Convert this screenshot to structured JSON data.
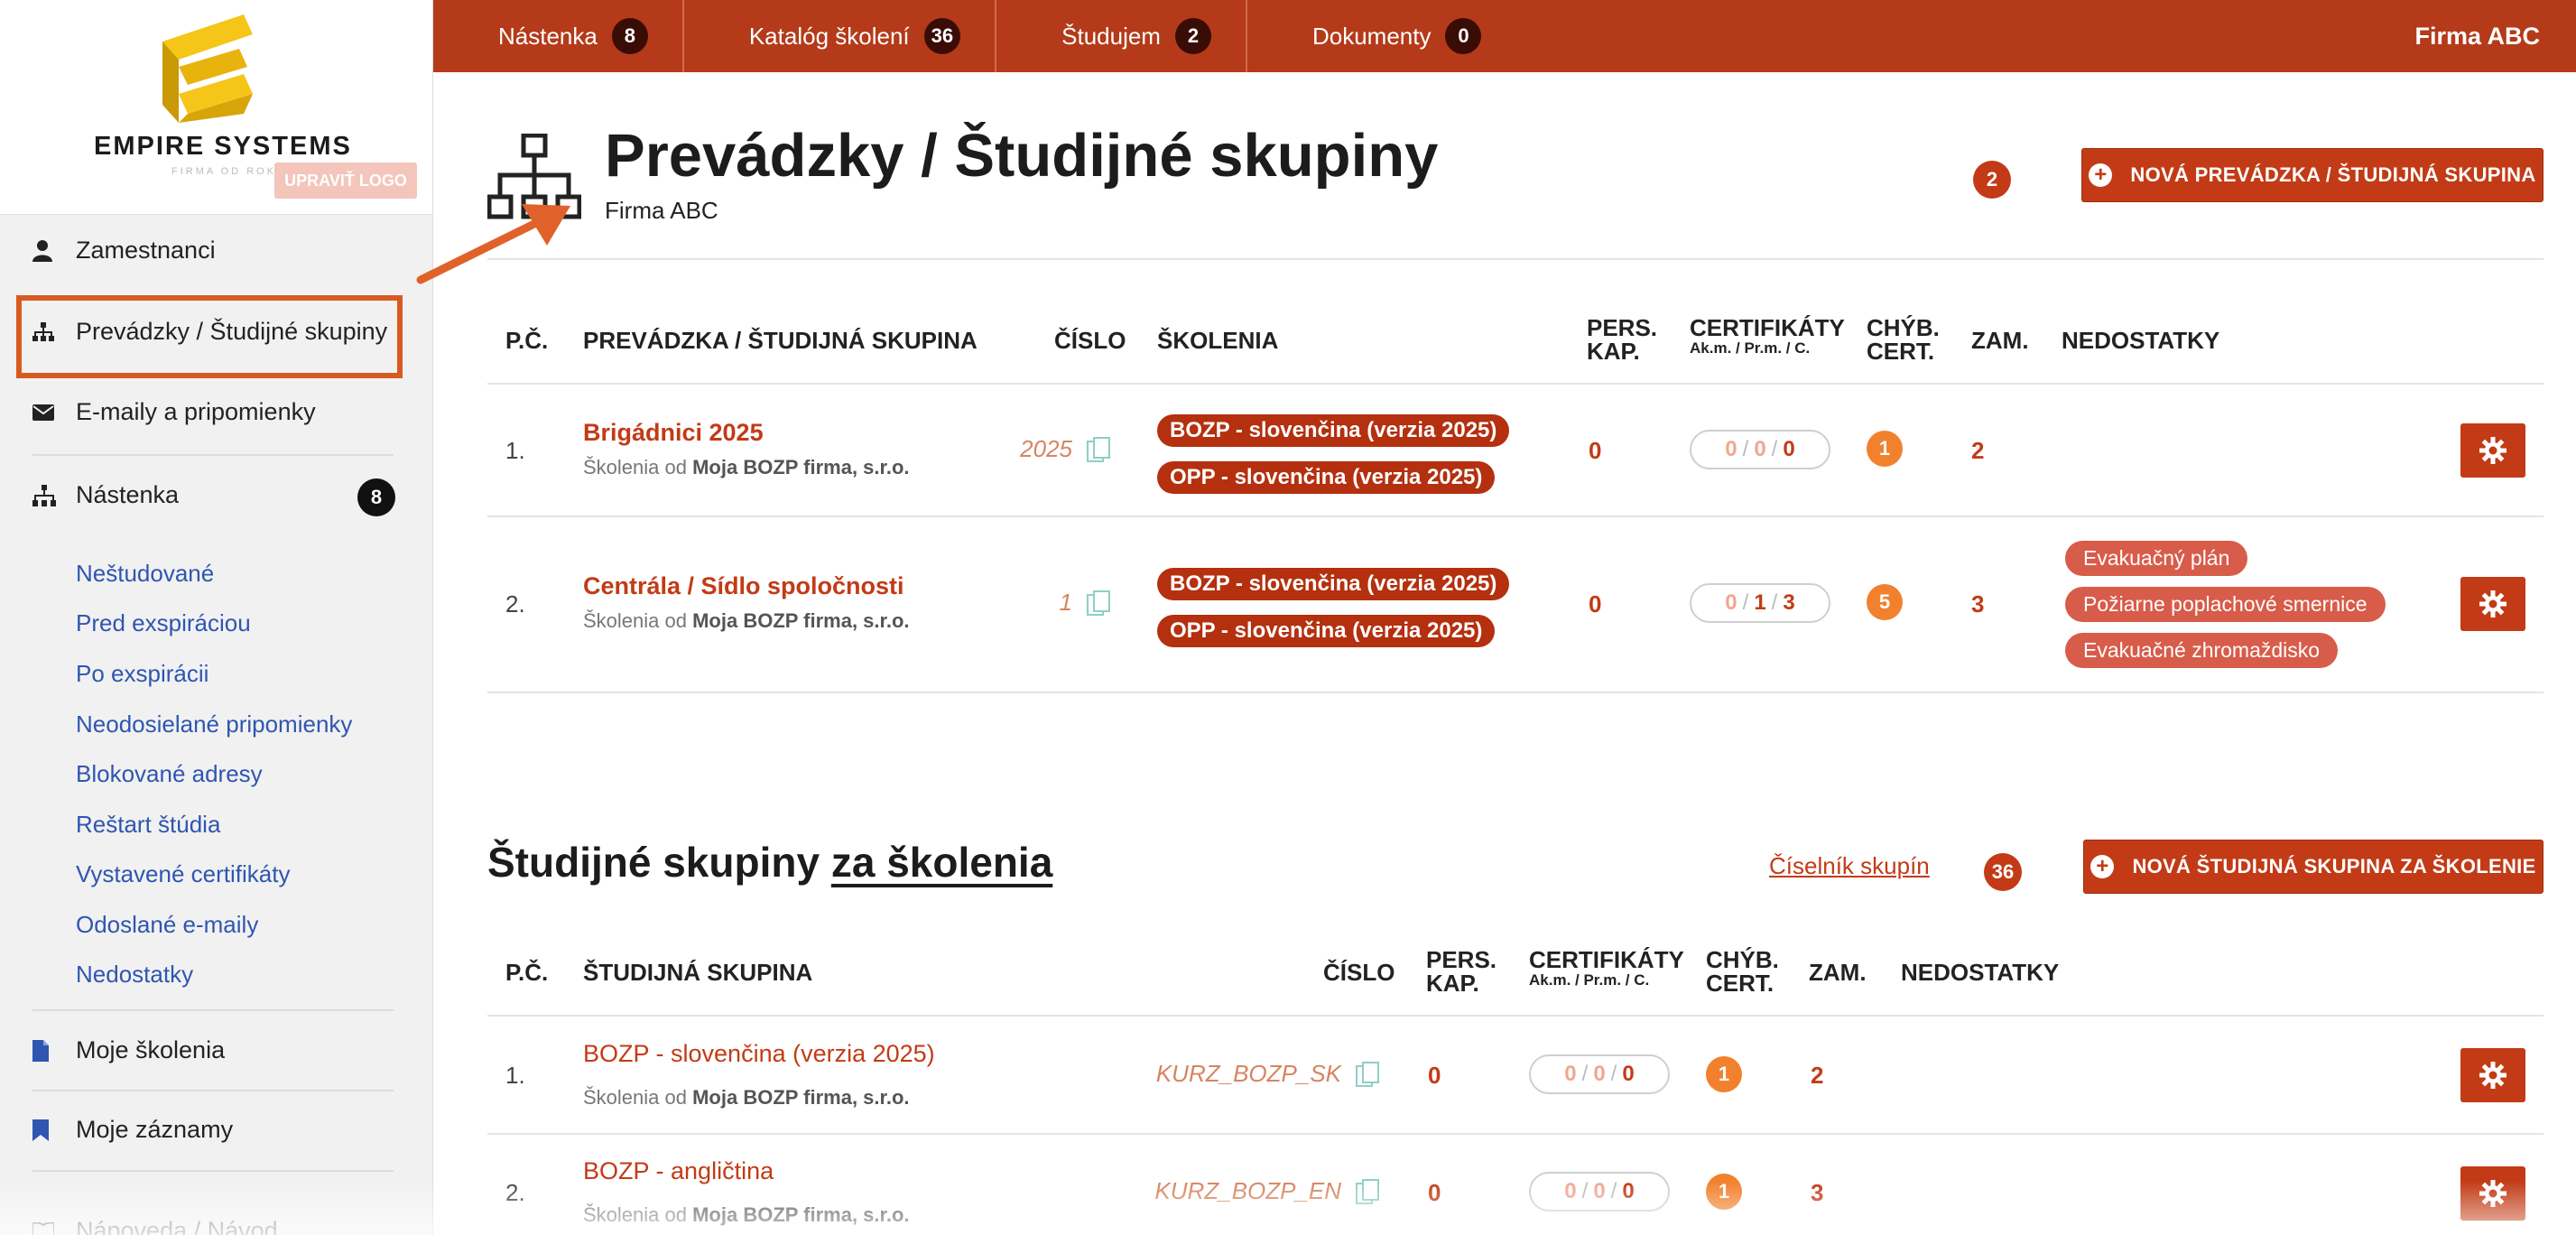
{
  "sidebar": {
    "logo_text": "EMPIRE SYSTEMS",
    "logo_sub": "FIRMA OD ROKU",
    "logo_button": "UPRAVIŤ LOGO",
    "items": [
      {
        "label": "Zamestnanci",
        "icon": "person-icon"
      },
      {
        "label": "Prevádzky / Študijné skupiny",
        "icon": "sitemap-icon",
        "active": true
      },
      {
        "label": "E-maily a pripomienky",
        "icon": "envelope-icon"
      },
      {
        "label": "Nástenka",
        "icon": "dashboard-icon",
        "badge": "8"
      }
    ],
    "sub_links": [
      "Neštudované",
      "Pred exspiráciou",
      "Po exspirácii",
      "Neodosielané pripomienky",
      "Blokované adresy",
      "Reštart štúdia",
      "Vystavené certifikáty",
      "Odoslané e-maily",
      "Nedostatky"
    ],
    "bottom_items": [
      {
        "label": "Moje školenia",
        "icon": "file-icon"
      },
      {
        "label": "Moje záznamy",
        "icon": "bookmark-icon"
      },
      {
        "label": "Nápoveda / Návod",
        "icon": "book-icon"
      }
    ]
  },
  "topbar": {
    "items": [
      {
        "label": "Nástenka",
        "badge": "8"
      },
      {
        "label": "Katalóg školení",
        "badge": "36"
      },
      {
        "label": "Študujem",
        "badge": "2"
      },
      {
        "label": "Dokumenty",
        "badge": "0"
      }
    ],
    "company": "Firma ABC"
  },
  "header": {
    "title": "Prevádzky / Študijné skupiny",
    "subtitle": "Firma ABC",
    "count": "2",
    "new_button": "NOVÁ PREVÁDZKA / ŠTUDIJNÁ SKUPINA"
  },
  "table1": {
    "columns": {
      "pc": "P.Č.",
      "name": "PREVÁDZKA / ŠTUDIJNÁ SKUPINA",
      "cislo": "ČÍSLO",
      "skolenia": "ŠKOLENIA",
      "pers1": "PERS.",
      "pers2": "KAP.",
      "cert": "CERTIFIKÁTY",
      "cert_sub": "Ak.m. / Pr.m. / C.",
      "chyb1": "CHÝB.",
      "chyb2": "CERT.",
      "zam": "ZAM.",
      "nedostatky": "NEDOSTATKY"
    },
    "rows": [
      {
        "num": "1.",
        "name": "Brigádnici 2025",
        "sub_prefix": "Školenia od",
        "sub_company": "Moja BOZP firma, s.r.o.",
        "cislo": "2025",
        "skolenia": [
          "BOZP - slovenčina (verzia 2025)",
          "OPP - slovenčina (verzia 2025)"
        ],
        "pers": "0",
        "cert": [
          "0",
          "0",
          "0"
        ],
        "chyb": "1",
        "zam": "2",
        "nedostatky": []
      },
      {
        "num": "2.",
        "name": "Centrála / Sídlo spoločnosti",
        "sub_prefix": "Školenia od",
        "sub_company": "Moja BOZP firma, s.r.o.",
        "cislo": "1",
        "skolenia": [
          "BOZP - slovenčina (verzia 2025)",
          "OPP - slovenčina (verzia 2025)"
        ],
        "pers": "0",
        "cert": [
          "0",
          "1",
          "3"
        ],
        "chyb": "5",
        "zam": "3",
        "nedostatky": [
          "Evakuačný plán",
          "Požiarne poplachové smernice",
          "Evakuačné zhromaždisko"
        ]
      }
    ]
  },
  "section2": {
    "title_prefix": "Študijné skupiny",
    "title_link": "za školenia",
    "ciselnik": "Číselník skupín",
    "count": "36",
    "new_button": "NOVÁ ŠTUDIJNÁ SKUPINA ZA ŠKOLENIE"
  },
  "table2": {
    "columns": {
      "pc": "P.Č.",
      "name": "ŠTUDIJNÁ SKUPINA",
      "cislo": "ČÍSLO",
      "pers1": "PERS.",
      "pers2": "KAP.",
      "cert": "CERTIFIKÁTY",
      "cert_sub": "Ak.m. / Pr.m. / C.",
      "chyb1": "CHÝB.",
      "chyb2": "CERT.",
      "zam": "ZAM.",
      "nedostatky": "NEDOSTATKY"
    },
    "rows": [
      {
        "num": "1.",
        "name": "BOZP - slovenčina (verzia 2025)",
        "sub_prefix": "Školenia od",
        "sub_company": "Moja BOZP firma, s.r.o.",
        "cislo": "KURZ_BOZP_SK",
        "pers": "0",
        "cert": [
          "0",
          "0",
          "0"
        ],
        "chyb": "1",
        "zam": "2"
      },
      {
        "num": "2.",
        "name": "BOZP - angličtina",
        "sub_prefix": "Školenia od",
        "sub_company": "Moja BOZP firma, s.r.o.",
        "cislo": "KURZ_BOZP_EN",
        "pers": "0",
        "cert": [
          "0",
          "0",
          "0"
        ],
        "chyb": "1",
        "zam": "3"
      }
    ]
  },
  "colors": {
    "primary": "#c23b16",
    "topbar": "#b43a1a",
    "link_blue": "#2f56b0",
    "orange_dot": "#f2812e",
    "highlight": "#d95a20"
  }
}
